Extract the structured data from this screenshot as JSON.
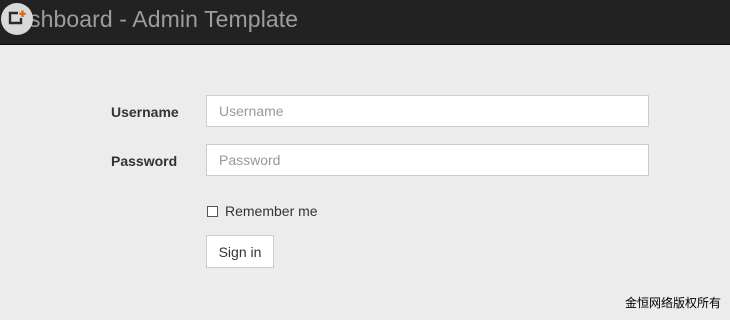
{
  "navbar": {
    "brand_visible": "shboard - Admin Template",
    "logo_icon": "logo-badge-icon",
    "background_color": "#222222",
    "brand_color": "#9d9d9d"
  },
  "login_form": {
    "username_label": "Username",
    "username_placeholder": "Username",
    "password_label": "Password",
    "password_placeholder": "Password",
    "remember_label": "Remember me",
    "remember_checked": false,
    "signin_label": "Sign in"
  },
  "footer": {
    "watermark": "金恒网络版权所有"
  }
}
